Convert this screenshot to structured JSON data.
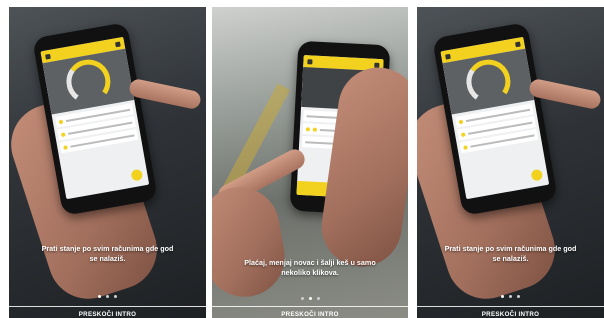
{
  "slides": [
    {
      "caption_line1": "Prati stanje po svim računima gde god",
      "caption_line2": "se nalaziš.",
      "skip_label": "PRESKOČI INTRO",
      "active_dot": 0
    },
    {
      "caption_line1": "Plaćaj, menjaj novac i šalji keš u samo",
      "caption_line2": "nekoliko klikova.",
      "skip_label": "PRESKOČI INTRO",
      "active_dot": 1
    },
    {
      "caption_line1": "Prati stanje po svim računima gde god",
      "caption_line2": "se nalaziš.",
      "skip_label": "PRESKOČI INTRO",
      "active_dot": 0
    }
  ],
  "dot_count": 3,
  "colors": {
    "accent": "#f2d21f",
    "text": "#ffffff"
  }
}
